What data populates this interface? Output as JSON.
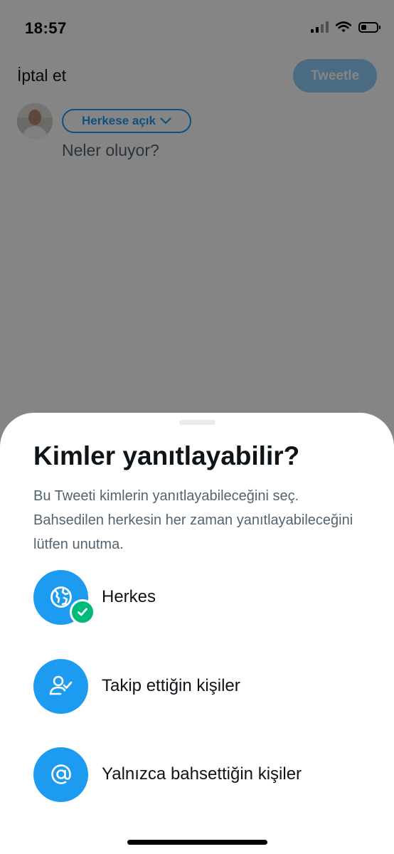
{
  "status_bar": {
    "time": "18:57",
    "battery_level": 0.35
  },
  "composer": {
    "cancel_label": "İptal et",
    "tweet_label": "Tweetle",
    "audience_label": "Herkese açık",
    "placeholder": "Neler oluyor?"
  },
  "sheet": {
    "title": "Kimler yanıtlayabilir?",
    "description": "Bu Tweeti kimlerin yanıtlayabileceğini seç. Bahsedilen herkesin her zaman yanıtlayabileceğini lütfen unutma.",
    "options": [
      {
        "label": "Herkes",
        "icon": "globe-icon",
        "selected": true
      },
      {
        "label": "Takip ettiğin kişiler",
        "icon": "person-check-icon",
        "selected": false
      },
      {
        "label": "Yalnızca bahsettiğin kişiler",
        "icon": "at-sign-icon",
        "selected": false
      }
    ]
  },
  "colors": {
    "accent": "#1d9bf0",
    "check": "#00ba7c",
    "tweet_disabled": "#8ecdf8"
  }
}
